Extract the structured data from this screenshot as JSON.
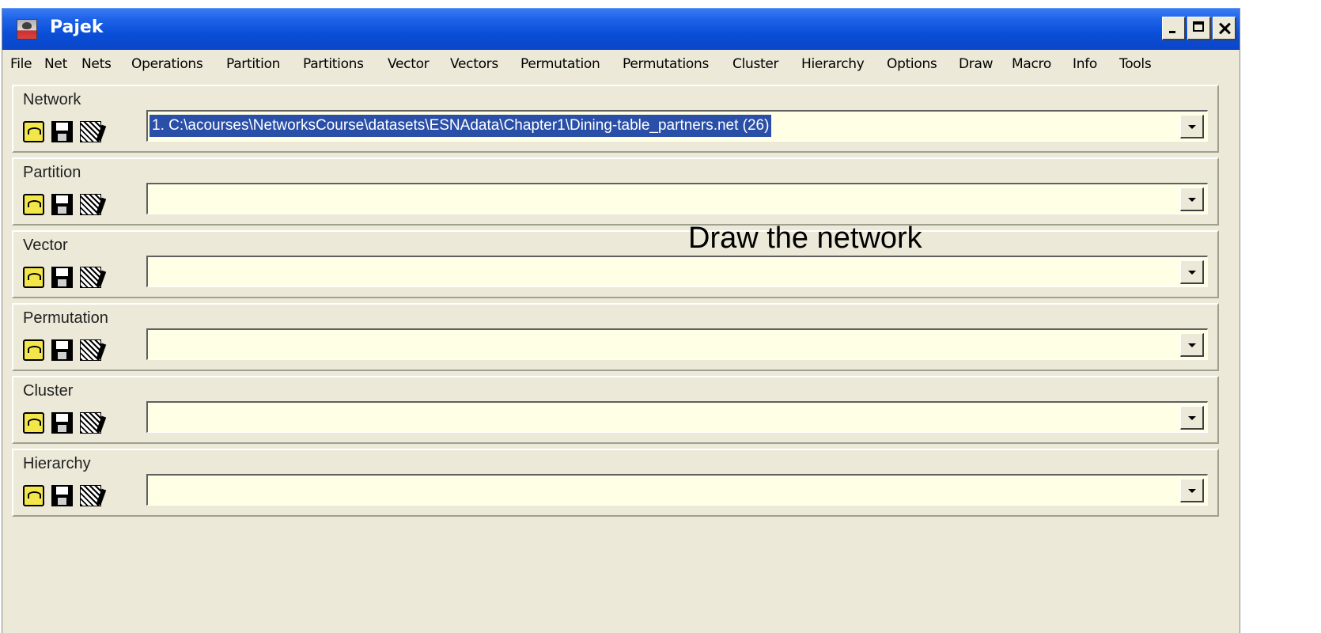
{
  "window": {
    "title": "Pajek",
    "controls": [
      "minimize",
      "maximize",
      "close"
    ]
  },
  "menu": [
    "File",
    "Net",
    "Nets",
    "Operations",
    "Partition",
    "Partitions",
    "Vector",
    "Vectors",
    "Permutation",
    "Permutations",
    "Cluster",
    "Hierarchy",
    "Options",
    "Draw",
    "Macro",
    "Info",
    "Tools"
  ],
  "panels": [
    {
      "label": "Network",
      "value": "1. C:\\acourses\\NetworksCourse\\datasets\\ESNAdata\\Chapter1\\Dining-table_partners.net (26)",
      "selected": true
    },
    {
      "label": "Partition",
      "value": ""
    },
    {
      "label": "Vector",
      "value": ""
    },
    {
      "label": "Permutation",
      "value": ""
    },
    {
      "label": "Cluster",
      "value": ""
    },
    {
      "label": "Hierarchy",
      "value": ""
    }
  ],
  "panel_icons": [
    "open-folder-icon",
    "save-disk-icon",
    "edit-icon"
  ],
  "annotation": "Draw the network",
  "colors": {
    "titlebar": "#0a4fd8",
    "window_bg": "#ece9d8",
    "combo_bg": "#ffffe6",
    "selection": "#2a4fa8",
    "marker": "#f5a21b"
  }
}
